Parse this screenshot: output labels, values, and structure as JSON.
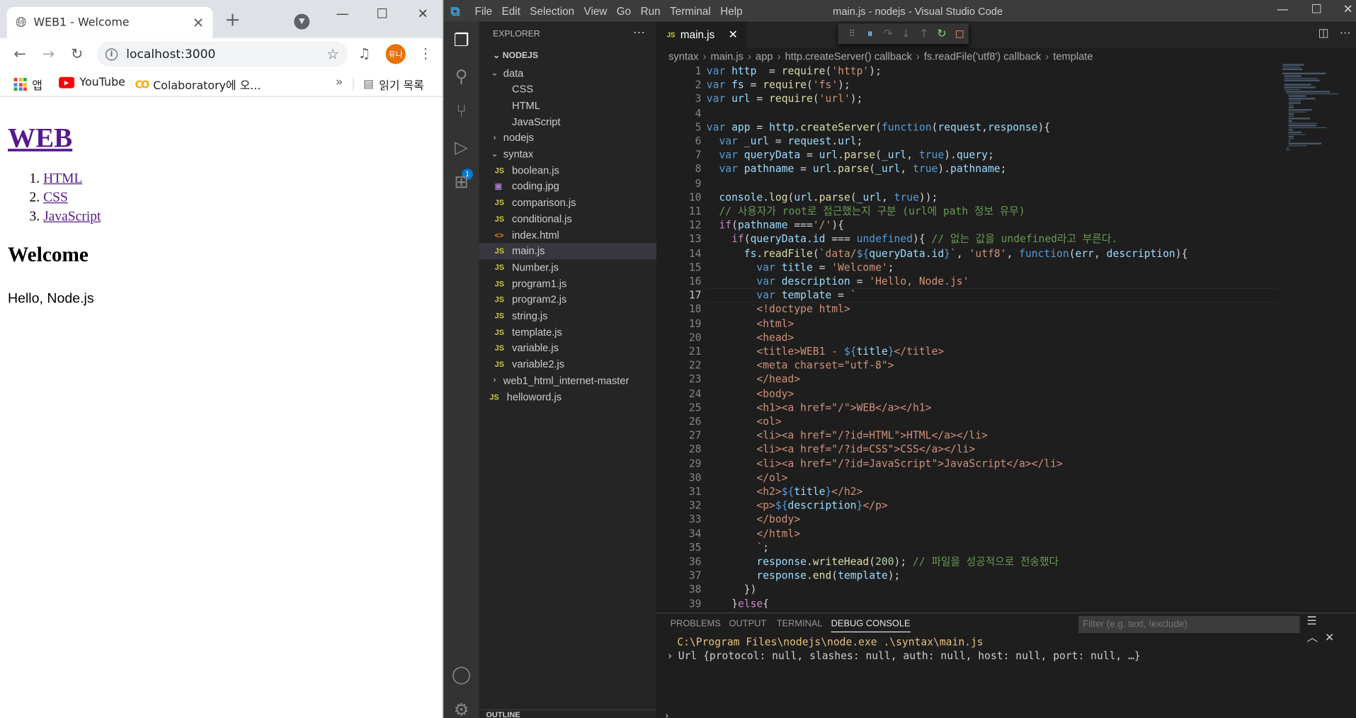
{
  "browser": {
    "tab_title": "WEB1 - Welcome",
    "url": "localhost:3000",
    "avatar_text": "유나",
    "bookmarks": [
      "앱",
      "YouTube",
      "Colaboratory에 오..."
    ],
    "bookmarks_more": "»",
    "reading_list": "읽기 목록",
    "page": {
      "h1": "WEB",
      "list": [
        "HTML",
        "CSS",
        "JavaScript"
      ],
      "h2": "Welcome",
      "p": "Hello, Node.js"
    }
  },
  "vscode": {
    "menu": [
      "File",
      "Edit",
      "Selection",
      "View",
      "Go",
      "Run",
      "Terminal",
      "Help"
    ],
    "window_title": "main.js - nodejs - Visual Studio Code",
    "explorer_title": "EXPLORER",
    "folder": "NODEJS",
    "debug_badge": "1",
    "tree": [
      {
        "label": "data",
        "type": "folder-open",
        "depth": 1
      },
      {
        "label": "CSS",
        "type": "file",
        "depth": 2
      },
      {
        "label": "HTML",
        "type": "file",
        "depth": 2
      },
      {
        "label": "JavaScript",
        "type": "file",
        "depth": 2
      },
      {
        "label": "nodejs",
        "type": "folder-closed",
        "depth": 1
      },
      {
        "label": "syntax",
        "type": "folder-open",
        "depth": 1
      },
      {
        "label": "boolean.js",
        "type": "js",
        "depth": 2
      },
      {
        "label": "coding.jpg",
        "type": "img",
        "depth": 2
      },
      {
        "label": "comparison.js",
        "type": "js",
        "depth": 2
      },
      {
        "label": "conditional.js",
        "type": "js",
        "depth": 2
      },
      {
        "label": "index.html",
        "type": "html",
        "depth": 2
      },
      {
        "label": "main.js",
        "type": "js",
        "depth": 2,
        "selected": true
      },
      {
        "label": "Number.js",
        "type": "js",
        "depth": 2
      },
      {
        "label": "program1.js",
        "type": "js",
        "depth": 2
      },
      {
        "label": "program2.js",
        "type": "js",
        "depth": 2
      },
      {
        "label": "string.js",
        "type": "js",
        "depth": 2
      },
      {
        "label": "template.js",
        "type": "js",
        "depth": 2
      },
      {
        "label": "variable.js",
        "type": "js",
        "depth": 2
      },
      {
        "label": "variable2.js",
        "type": "js",
        "depth": 2
      },
      {
        "label": "web1_html_internet-master",
        "type": "folder-closed",
        "depth": 1
      },
      {
        "label": "helloword.js",
        "type": "js",
        "depth": 1
      }
    ],
    "outline": "OUTLINE",
    "editor_tab": "main.js",
    "breadcrumb": [
      "syntax",
      "main.js",
      "app",
      "http.createServer() callback",
      "fs.readFile('utf8') callback",
      "template"
    ],
    "current_line": 17,
    "code_lines": [
      [
        [
          "k",
          "var "
        ],
        [
          "v",
          "http"
        ],
        [
          "",
          "  = "
        ],
        [
          "f",
          "require"
        ],
        [
          "",
          "("
        ],
        [
          "s",
          "'http'"
        ],
        [
          "",
          ");"
        ]
      ],
      [
        [
          "k",
          "var "
        ],
        [
          "v",
          "fs"
        ],
        [
          "",
          " = "
        ],
        [
          "f",
          "require"
        ],
        [
          "",
          "("
        ],
        [
          "s",
          "'fs'"
        ],
        [
          "",
          ");"
        ]
      ],
      [
        [
          "k",
          "var "
        ],
        [
          "v",
          "url"
        ],
        [
          "",
          " = "
        ],
        [
          "f",
          "require"
        ],
        [
          "",
          "("
        ],
        [
          "s",
          "'url'"
        ],
        [
          "",
          ");"
        ]
      ],
      [],
      [
        [
          "k",
          "var "
        ],
        [
          "v",
          "app"
        ],
        [
          "",
          " = "
        ],
        [
          "v",
          "http"
        ],
        [
          "",
          "."
        ],
        [
          "f",
          "createServer"
        ],
        [
          "",
          "("
        ],
        [
          "k",
          "function"
        ],
        [
          "",
          "("
        ],
        [
          "v",
          "request"
        ],
        [
          "",
          ","
        ],
        [
          "v",
          "response"
        ],
        [
          "",
          "){"
        ]
      ],
      [
        [
          "",
          "  "
        ],
        [
          "k",
          "var "
        ],
        [
          "v",
          "_url"
        ],
        [
          "",
          " = "
        ],
        [
          "v",
          "request"
        ],
        [
          "",
          "."
        ],
        [
          "v",
          "url"
        ],
        [
          "",
          ";"
        ]
      ],
      [
        [
          "",
          "  "
        ],
        [
          "k",
          "var "
        ],
        [
          "v",
          "queryData"
        ],
        [
          "",
          " = "
        ],
        [
          "v",
          "url"
        ],
        [
          "",
          "."
        ],
        [
          "f",
          "parse"
        ],
        [
          "",
          "("
        ],
        [
          "v",
          "_url"
        ],
        [
          "",
          ", "
        ],
        [
          "k",
          "true"
        ],
        [
          "",
          ")."
        ],
        [
          "v",
          "query"
        ],
        [
          "",
          ";"
        ]
      ],
      [
        [
          "",
          "  "
        ],
        [
          "k",
          "var "
        ],
        [
          "v",
          "pathname"
        ],
        [
          "",
          " = "
        ],
        [
          "v",
          "url"
        ],
        [
          "",
          "."
        ],
        [
          "f",
          "parse"
        ],
        [
          "",
          "("
        ],
        [
          "v",
          "_url"
        ],
        [
          "",
          ", "
        ],
        [
          "k",
          "true"
        ],
        [
          "",
          ")."
        ],
        [
          "v",
          "pathname"
        ],
        [
          "",
          ";"
        ]
      ],
      [],
      [
        [
          "",
          "  "
        ],
        [
          "v",
          "console"
        ],
        [
          "",
          "."
        ],
        [
          "f",
          "log"
        ],
        [
          "",
          "("
        ],
        [
          "v",
          "url"
        ],
        [
          "",
          "."
        ],
        [
          "f",
          "parse"
        ],
        [
          "",
          "("
        ],
        [
          "v",
          "_url"
        ],
        [
          "",
          ", "
        ],
        [
          "k",
          "true"
        ],
        [
          "",
          "));"
        ]
      ],
      [
        [
          "",
          "  "
        ],
        [
          "c",
          "// 사용자가 root로 접근했는지 구분 (url에 path 정보 유무)"
        ]
      ],
      [
        [
          "",
          "  "
        ],
        [
          "p",
          "if"
        ],
        [
          "",
          "("
        ],
        [
          "v",
          "pathname"
        ],
        [
          "",
          " ==="
        ],
        [
          "s",
          "'/'"
        ],
        [
          "",
          "){"
        ]
      ],
      [
        [
          "",
          "    "
        ],
        [
          "p",
          "if"
        ],
        [
          "",
          "("
        ],
        [
          "v",
          "queryData"
        ],
        [
          "",
          "."
        ],
        [
          "v",
          "id"
        ],
        [
          "",
          " === "
        ],
        [
          "k",
          "undefined"
        ],
        [
          "",
          "){ "
        ],
        [
          "c",
          "// 없는 값을 undefined라고 부른다."
        ]
      ],
      [
        [
          "",
          "      "
        ],
        [
          "v",
          "fs"
        ],
        [
          "",
          "."
        ],
        [
          "f",
          "readFile"
        ],
        [
          "",
          "("
        ],
        [
          "s",
          "`data/"
        ],
        [
          "k",
          "${"
        ],
        [
          "v",
          "queryData"
        ],
        [
          "",
          "."
        ],
        [
          "v",
          "id"
        ],
        [
          "k",
          "}"
        ],
        [
          "s",
          "`"
        ],
        [
          "",
          ", "
        ],
        [
          "s",
          "'utf8'"
        ],
        [
          "",
          ", "
        ],
        [
          "k",
          "function"
        ],
        [
          "",
          "("
        ],
        [
          "v",
          "err"
        ],
        [
          "",
          ", "
        ],
        [
          "v",
          "description"
        ],
        [
          "",
          "){"
        ]
      ],
      [
        [
          "",
          "        "
        ],
        [
          "k",
          "var "
        ],
        [
          "v",
          "title"
        ],
        [
          "",
          " = "
        ],
        [
          "s",
          "'Welcome'"
        ],
        [
          "",
          ";"
        ]
      ],
      [
        [
          "",
          "        "
        ],
        [
          "k",
          "var "
        ],
        [
          "v",
          "description"
        ],
        [
          "",
          " = "
        ],
        [
          "s",
          "'Hello, Node.js'"
        ]
      ],
      [
        [
          "",
          "        "
        ],
        [
          "k",
          "var "
        ],
        [
          "v",
          "template"
        ],
        [
          "",
          " = "
        ],
        [
          "s",
          "`"
        ]
      ],
      [
        [
          "",
          "        "
        ],
        [
          "s",
          "<!doctype html>"
        ]
      ],
      [
        [
          "",
          "        "
        ],
        [
          "s",
          "<html>"
        ]
      ],
      [
        [
          "",
          "        "
        ],
        [
          "s",
          "<head>"
        ]
      ],
      [
        [
          "",
          "        "
        ],
        [
          "s",
          "<title>WEB1 - "
        ],
        [
          "k",
          "${"
        ],
        [
          "v",
          "title"
        ],
        [
          "k",
          "}"
        ],
        [
          "s",
          "</title>"
        ]
      ],
      [
        [
          "",
          "        "
        ],
        [
          "s",
          "<meta charset=\"utf-8\">"
        ]
      ],
      [
        [
          "",
          "        "
        ],
        [
          "s",
          "</head>"
        ]
      ],
      [
        [
          "",
          "        "
        ],
        [
          "s",
          "<body>"
        ]
      ],
      [
        [
          "",
          "        "
        ],
        [
          "s",
          "<h1><a href=\"/\">WEB</a></h1>"
        ]
      ],
      [
        [
          "",
          "        "
        ],
        [
          "s",
          "<ol>"
        ]
      ],
      [
        [
          "",
          "        "
        ],
        [
          "s",
          "<li><a href=\"/?id=HTML\">HTML</a></li>"
        ]
      ],
      [
        [
          "",
          "        "
        ],
        [
          "s",
          "<li><a href=\"/?id=CSS\">CSS</a></li>"
        ]
      ],
      [
        [
          "",
          "        "
        ],
        [
          "s",
          "<li><a href=\"/?id=JavaScript\">JavaScript</a></li>"
        ]
      ],
      [
        [
          "",
          "        "
        ],
        [
          "s",
          "</ol>"
        ]
      ],
      [
        [
          "",
          "        "
        ],
        [
          "s",
          "<h2>"
        ],
        [
          "k",
          "${"
        ],
        [
          "v",
          "title"
        ],
        [
          "k",
          "}"
        ],
        [
          "s",
          "</h2>"
        ]
      ],
      [
        [
          "",
          "        "
        ],
        [
          "s",
          "<p>"
        ],
        [
          "k",
          "${"
        ],
        [
          "v",
          "description"
        ],
        [
          "k",
          "}"
        ],
        [
          "s",
          "</p>"
        ]
      ],
      [
        [
          "",
          "        "
        ],
        [
          "s",
          "</body>"
        ]
      ],
      [
        [
          "",
          "        "
        ],
        [
          "s",
          "</html>"
        ]
      ],
      [
        [
          "",
          "        "
        ],
        [
          "s",
          "`"
        ],
        [
          "",
          ";"
        ]
      ],
      [
        [
          "",
          "        "
        ],
        [
          "v",
          "response"
        ],
        [
          "",
          "."
        ],
        [
          "f",
          "writeHead"
        ],
        [
          "",
          "("
        ],
        [
          "n",
          "200"
        ],
        [
          "",
          "); "
        ],
        [
          "c",
          "// 파일을 성공적으로 전송했다"
        ]
      ],
      [
        [
          "",
          "        "
        ],
        [
          "v",
          "response"
        ],
        [
          "",
          "."
        ],
        [
          "f",
          "end"
        ],
        [
          "",
          "("
        ],
        [
          "v",
          "template"
        ],
        [
          "",
          ");"
        ]
      ],
      [
        [
          "",
          "      "
        ],
        [
          "",
          "})"
        ]
      ],
      [
        [
          "",
          "    "
        ],
        [
          "",
          "}"
        ],
        [
          "p",
          "else"
        ],
        [
          "",
          "{"
        ]
      ]
    ],
    "panel_tabs": [
      "PROBLEMS",
      "OUTPUT",
      "TERMINAL",
      "DEBUG CONSOLE"
    ],
    "panel_active": "DEBUG CONSOLE",
    "filter_placeholder": "Filter (e.g. text, !exclude)",
    "console": [
      "C:\\Program Files\\nodejs\\node.exe .\\syntax\\main.js",
      "Url {protocol: null, slashes: null, auth: null, host: null, port: null, …}"
    ]
  }
}
